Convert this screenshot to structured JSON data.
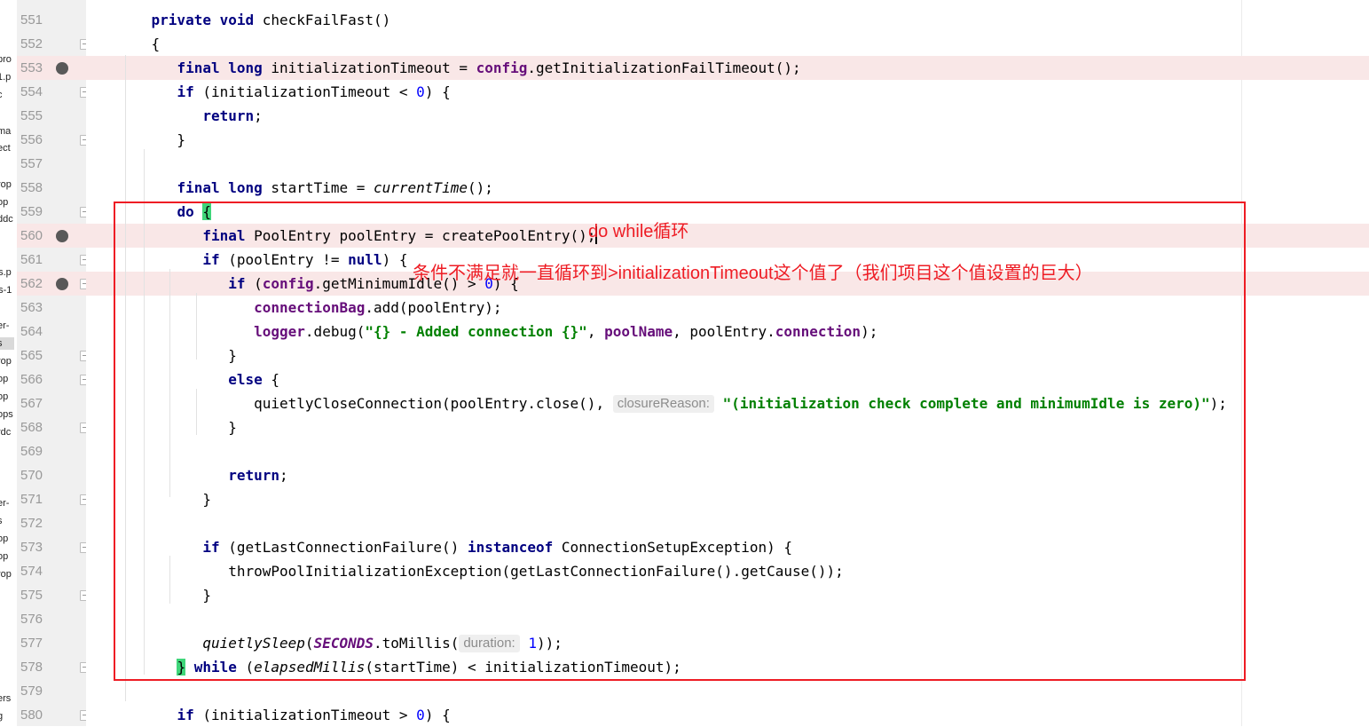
{
  "sidebar": {
    "fragments": [
      {
        "text": "pro",
        "selected": false
      },
      {
        "text": "1.p",
        "selected": false
      },
      {
        "text": "c",
        "selected": false
      },
      {
        "text": "ma",
        "selected": false
      },
      {
        "text": "ect",
        "selected": false
      },
      {
        "text": "rop",
        "selected": false
      },
      {
        "text": "op",
        "selected": false
      },
      {
        "text": "ddc",
        "selected": false
      },
      {
        "text": "os.p",
        "selected": false
      },
      {
        "text": "os-1",
        "selected": false
      },
      {
        "text": "er-",
        "selected": false
      },
      {
        "text": "s",
        "selected": true
      },
      {
        "text": "rop",
        "selected": false
      },
      {
        "text": "op",
        "selected": false
      },
      {
        "text": "op",
        "selected": false
      },
      {
        "text": "ops",
        "selected": false
      },
      {
        "text": "rdc",
        "selected": false
      },
      {
        "text": "er-",
        "selected": false
      },
      {
        "text": "s",
        "selected": false
      },
      {
        "text": "op",
        "selected": false
      },
      {
        "text": "op",
        "selected": false
      },
      {
        "text": "rop",
        "selected": false
      },
      {
        "text": "ers",
        "selected": false
      },
      {
        "text": "g",
        "selected": false
      }
    ]
  },
  "editor": {
    "lines": [
      {
        "num": "551",
        "breakpoint": false,
        "fold": false,
        "current": false,
        "tokens": [
          [
            "    ",
            ""
          ],
          [
            "private ",
            "kw"
          ],
          [
            "void ",
            "kw"
          ],
          [
            "checkFailFast",
            ""
          ],
          [
            "()",
            ""
          ]
        ]
      },
      {
        "num": "552",
        "breakpoint": false,
        "fold": true,
        "current": false,
        "tokens": [
          [
            "    {",
            ""
          ]
        ]
      },
      {
        "num": "553",
        "breakpoint": true,
        "fold": false,
        "current": false,
        "tokens": [
          [
            "       ",
            ""
          ],
          [
            "final ",
            "kw"
          ],
          [
            "long ",
            "kw"
          ],
          [
            "initializationTimeout = ",
            ""
          ],
          [
            "config",
            "fld"
          ],
          [
            ".getInitializationFailTimeout();",
            ""
          ]
        ]
      },
      {
        "num": "554",
        "breakpoint": false,
        "fold": true,
        "current": false,
        "tokens": [
          [
            "       ",
            ""
          ],
          [
            "if ",
            "kw"
          ],
          [
            "(initializationTimeout < ",
            ""
          ],
          [
            "0",
            "num"
          ],
          [
            ") {",
            ""
          ]
        ]
      },
      {
        "num": "555",
        "breakpoint": false,
        "fold": false,
        "current": false,
        "tokens": [
          [
            "          ",
            ""
          ],
          [
            "return",
            "kw"
          ],
          [
            ";",
            ""
          ]
        ]
      },
      {
        "num": "556",
        "breakpoint": false,
        "fold": true,
        "current": false,
        "tokens": [
          [
            "       }",
            ""
          ]
        ]
      },
      {
        "num": "557",
        "breakpoint": false,
        "fold": false,
        "current": false,
        "tokens": [
          [
            "",
            ""
          ]
        ]
      },
      {
        "num": "558",
        "breakpoint": false,
        "fold": false,
        "current": false,
        "tokens": [
          [
            "       ",
            ""
          ],
          [
            "final ",
            "kw"
          ],
          [
            "long ",
            "kw"
          ],
          [
            "startTime = ",
            ""
          ],
          [
            "currentTime",
            "it"
          ],
          [
            "();",
            ""
          ]
        ]
      },
      {
        "num": "559",
        "breakpoint": false,
        "fold": true,
        "current": false,
        "tokens": [
          [
            "       ",
            ""
          ],
          [
            "do ",
            "kw"
          ],
          [
            "{",
            "brace-hl"
          ]
        ]
      },
      {
        "num": "560",
        "breakpoint": true,
        "fold": false,
        "current": true,
        "tokens": [
          [
            "          ",
            ""
          ],
          [
            "final ",
            "kw"
          ],
          [
            "PoolEntry poolEntry = createPoolEntry();",
            ""
          ],
          [
            "",
            "caret"
          ]
        ]
      },
      {
        "num": "561",
        "breakpoint": false,
        "fold": true,
        "current": false,
        "tokens": [
          [
            "          ",
            ""
          ],
          [
            "if ",
            "kw"
          ],
          [
            "(poolEntry != ",
            ""
          ],
          [
            "null",
            "kw"
          ],
          [
            ") {",
            ""
          ]
        ]
      },
      {
        "num": "562",
        "breakpoint": true,
        "fold": true,
        "current": false,
        "tokens": [
          [
            "             ",
            ""
          ],
          [
            "if ",
            "kw"
          ],
          [
            "(",
            ""
          ],
          [
            "config",
            "fld"
          ],
          [
            ".getMinimumIdle() > ",
            ""
          ],
          [
            "0",
            "num"
          ],
          [
            ") {",
            ""
          ]
        ]
      },
      {
        "num": "563",
        "breakpoint": false,
        "fold": false,
        "current": false,
        "tokens": [
          [
            "                ",
            ""
          ],
          [
            "connectionBag",
            "fld"
          ],
          [
            ".add(poolEntry);",
            ""
          ]
        ]
      },
      {
        "num": "564",
        "breakpoint": false,
        "fold": false,
        "current": false,
        "tokens": [
          [
            "                ",
            ""
          ],
          [
            "logger",
            "fld"
          ],
          [
            ".debug(",
            ""
          ],
          [
            "\"{} - Added connection {}\"",
            "str"
          ],
          [
            ", ",
            ""
          ],
          [
            "poolName",
            "fld"
          ],
          [
            ", poolEntry.",
            ""
          ],
          [
            "connection",
            "fld"
          ],
          [
            ");",
            ""
          ]
        ]
      },
      {
        "num": "565",
        "breakpoint": false,
        "fold": true,
        "current": false,
        "tokens": [
          [
            "             }",
            ""
          ]
        ]
      },
      {
        "num": "566",
        "breakpoint": false,
        "fold": true,
        "current": false,
        "tokens": [
          [
            "             ",
            ""
          ],
          [
            "else ",
            "kw"
          ],
          [
            "{",
            ""
          ]
        ]
      },
      {
        "num": "567",
        "breakpoint": false,
        "fold": false,
        "current": false,
        "tokens": [
          [
            "                quietlyCloseConnection(poolEntry.close(), ",
            ""
          ],
          [
            "closureReason:",
            "hint"
          ],
          [
            " ",
            ""
          ],
          [
            "\"(initialization check complete and minimumIdle is zero)\"",
            "str"
          ],
          [
            ");",
            ""
          ]
        ]
      },
      {
        "num": "568",
        "breakpoint": false,
        "fold": true,
        "current": false,
        "tokens": [
          [
            "             }",
            ""
          ]
        ]
      },
      {
        "num": "569",
        "breakpoint": false,
        "fold": false,
        "current": false,
        "tokens": [
          [
            "",
            ""
          ]
        ]
      },
      {
        "num": "570",
        "breakpoint": false,
        "fold": false,
        "current": false,
        "tokens": [
          [
            "             ",
            ""
          ],
          [
            "return",
            "kw"
          ],
          [
            ";",
            ""
          ]
        ]
      },
      {
        "num": "571",
        "breakpoint": false,
        "fold": true,
        "current": false,
        "tokens": [
          [
            "          }",
            ""
          ]
        ]
      },
      {
        "num": "572",
        "breakpoint": false,
        "fold": false,
        "current": false,
        "tokens": [
          [
            "",
            ""
          ]
        ]
      },
      {
        "num": "573",
        "breakpoint": false,
        "fold": true,
        "current": false,
        "tokens": [
          [
            "          ",
            ""
          ],
          [
            "if ",
            "kw"
          ],
          [
            "(getLastConnectionFailure() ",
            ""
          ],
          [
            "instanceof ",
            "kw"
          ],
          [
            "ConnectionSetupException) {",
            ""
          ]
        ]
      },
      {
        "num": "574",
        "breakpoint": false,
        "fold": false,
        "current": false,
        "tokens": [
          [
            "             throwPoolInitializationException(getLastConnectionFailure().getCause());",
            ""
          ]
        ]
      },
      {
        "num": "575",
        "breakpoint": false,
        "fold": true,
        "current": false,
        "tokens": [
          [
            "          }",
            ""
          ]
        ]
      },
      {
        "num": "576",
        "breakpoint": false,
        "fold": false,
        "current": false,
        "tokens": [
          [
            "",
            ""
          ]
        ]
      },
      {
        "num": "577",
        "breakpoint": false,
        "fold": false,
        "current": false,
        "tokens": [
          [
            "          ",
            ""
          ],
          [
            "quietlySleep",
            "it"
          ],
          [
            "(",
            ""
          ],
          [
            "SECONDS",
            "const"
          ],
          [
            ".toMillis(",
            ""
          ],
          [
            "duration:",
            "hint"
          ],
          [
            " ",
            ""
          ],
          [
            "1",
            "num"
          ],
          [
            "));",
            ""
          ]
        ]
      },
      {
        "num": "578",
        "breakpoint": false,
        "fold": true,
        "current": false,
        "tokens": [
          [
            "       ",
            ""
          ],
          [
            "}",
            "brace-hl"
          ],
          [
            " ",
            ""
          ],
          [
            "while ",
            "kw"
          ],
          [
            "(",
            ""
          ],
          [
            "elapsedMillis",
            "it"
          ],
          [
            "(startTime) < initializationTimeout);",
            ""
          ]
        ]
      },
      {
        "num": "579",
        "breakpoint": false,
        "fold": false,
        "current": false,
        "tokens": [
          [
            "",
            ""
          ]
        ]
      },
      {
        "num": "580",
        "breakpoint": false,
        "fold": true,
        "current": false,
        "tokens": [
          [
            "       ",
            ""
          ],
          [
            "if ",
            "kw"
          ],
          [
            "(initializationTimeout > ",
            ""
          ],
          [
            "0",
            "num"
          ],
          [
            ") {",
            ""
          ]
        ]
      }
    ]
  },
  "annotations": {
    "label_1": "do while循环",
    "label_2": "条件不满足就一直循环到>initializationTimeout这个值了（我们项目这个值设置的巨大）",
    "color": "#ee1c24"
  },
  "colors": {
    "keyword": "#000080",
    "field": "#660e7a",
    "string": "#008000",
    "number": "#0000ff",
    "breakpoint_line": "#f9e7e7",
    "current_line": "#fcf7e2",
    "brace_match": "#3fd67a"
  }
}
